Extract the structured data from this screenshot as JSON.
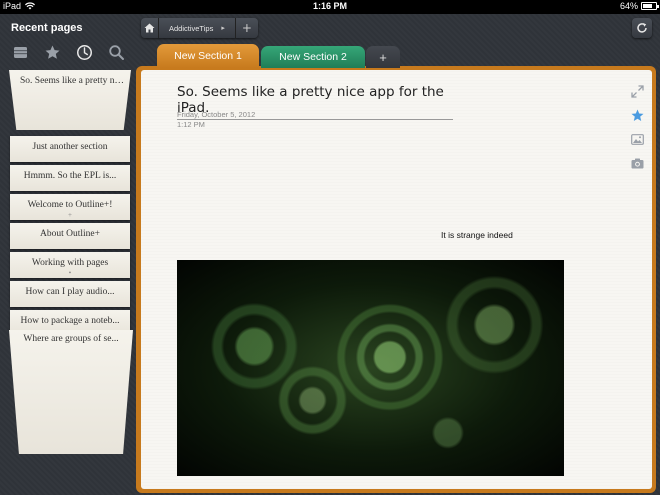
{
  "status_bar": {
    "device": "iPad",
    "time": "1:16 PM",
    "battery": "64%",
    "battery_level": 0.64
  },
  "sidebar": {
    "title": "Recent pages",
    "tools": [
      {
        "name": "notebooks-icon"
      },
      {
        "name": "favorites-icon"
      },
      {
        "name": "recent-icon",
        "active": true
      },
      {
        "name": "search-icon"
      }
    ],
    "pages": [
      {
        "label": "So. Seems like a pretty nice app for the iPad."
      },
      {
        "label": "Just another section"
      },
      {
        "label": "Hmmm. So the EPL is..."
      },
      {
        "label": "Welcome to Outline+!",
        "dot": "+"
      },
      {
        "label": "About Outline+"
      },
      {
        "label": "Working with pages",
        "dot": "•"
      },
      {
        "label": "How can I play audio..."
      },
      {
        "label": "How to package a noteb..."
      },
      {
        "label": "Where are groups of se..."
      }
    ]
  },
  "breadcrumb": {
    "notebook": "AddictiveTips",
    "add_label": "+"
  },
  "tabs": [
    {
      "label": "New Section 1",
      "color": "#d9892a",
      "active": true
    },
    {
      "label": "New Section 2",
      "color": "#2a9a6b"
    },
    {
      "label": "+"
    }
  ],
  "note": {
    "title": "So. Seems like a pretty nice app for the iPad.",
    "date": "Friday, October 5, 2012",
    "time": "1:12 PM",
    "text": "It is strange indeed"
  },
  "colors": {
    "accent_orange": "#d9892a",
    "accent_green": "#2a9a6b",
    "chrome": "#30343a",
    "paper": "#f7f6f2",
    "star_blue": "#4a9be0"
  }
}
